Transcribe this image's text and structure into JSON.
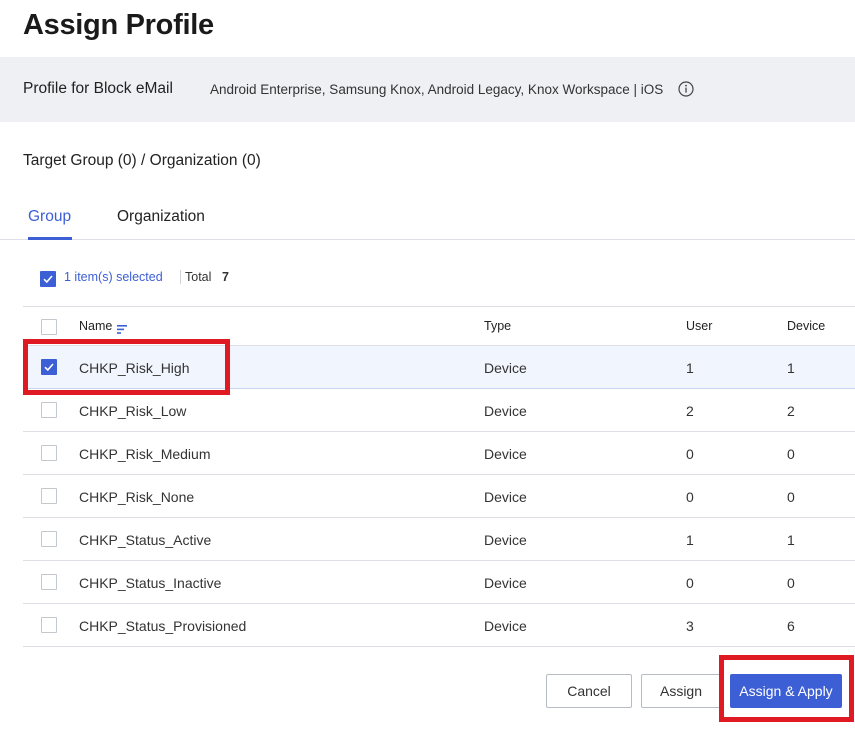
{
  "page": {
    "title": "Assign Profile"
  },
  "profile": {
    "name": "Profile for Block eMail",
    "platforms": "Android Enterprise, Samsung Knox, Android Legacy, Knox Workspace | iOS"
  },
  "target_summary": "Target Group (0) / Organization (0)",
  "tabs": [
    {
      "label": "Group",
      "active": true
    },
    {
      "label": "Organization",
      "active": false
    }
  ],
  "selection": {
    "selected_text": "1 item(s) selected",
    "total_label": "Total",
    "total_value": "7"
  },
  "table": {
    "columns": {
      "name": "Name",
      "type": "Type",
      "user": "User",
      "device": "Device"
    },
    "rows": [
      {
        "name": "CHKP_Risk_High",
        "type": "Device",
        "user": "1",
        "device": "1",
        "checked": true
      },
      {
        "name": "CHKP_Risk_Low",
        "type": "Device",
        "user": "2",
        "device": "2",
        "checked": false
      },
      {
        "name": "CHKP_Risk_Medium",
        "type": "Device",
        "user": "0",
        "device": "0",
        "checked": false
      },
      {
        "name": "CHKP_Risk_None",
        "type": "Device",
        "user": "0",
        "device": "0",
        "checked": false
      },
      {
        "name": "CHKP_Status_Active",
        "type": "Device",
        "user": "1",
        "device": "1",
        "checked": false
      },
      {
        "name": "CHKP_Status_Inactive",
        "type": "Device",
        "user": "0",
        "device": "0",
        "checked": false
      },
      {
        "name": "CHKP_Status_Provisioned",
        "type": "Device",
        "user": "3",
        "device": "6",
        "checked": false
      }
    ]
  },
  "buttons": {
    "cancel": "Cancel",
    "assign": "Assign",
    "assign_apply": "Assign & Apply"
  },
  "colors": {
    "accent": "#3c5fd6",
    "highlight": "#e01a22",
    "banner_bg": "#eef0f4"
  },
  "icons": {
    "info": "info-icon",
    "check": "check-icon",
    "sort": "sort-icon"
  }
}
